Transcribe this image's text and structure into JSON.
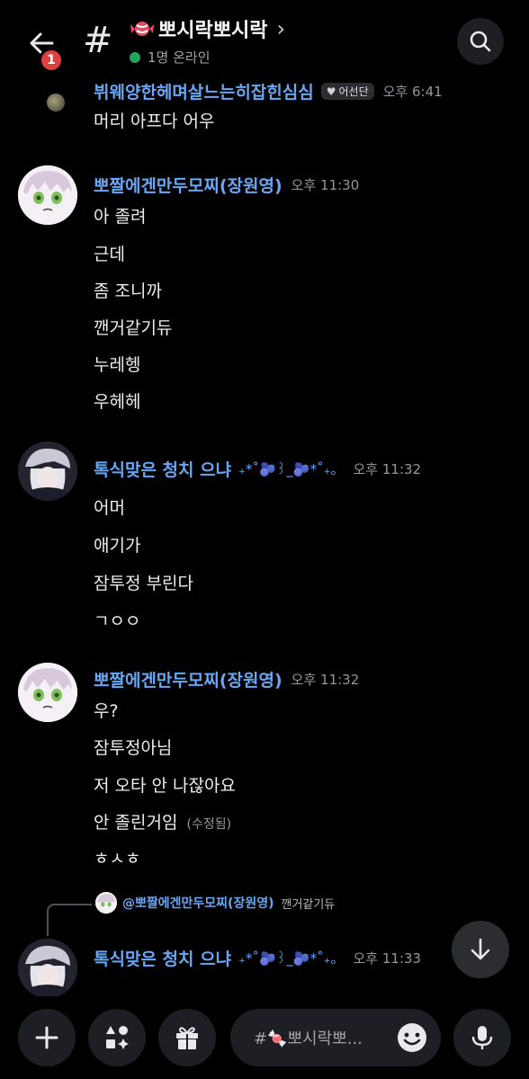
{
  "header": {
    "unread_count": "1",
    "channel_name": "뽀시락뽀시락",
    "online_status": "1명 온라인"
  },
  "messages": [
    {
      "author": "뷔웨양한헤며살느는히잡힌심심",
      "tag": "어선단",
      "time": "오후 6:41",
      "lines": [
        "머리 아프다 어우"
      ]
    },
    {
      "author": "뽀짤에겐만두모찌(장원영)",
      "time": "오후 11:30",
      "lines": [
        "아 졸려",
        "근데",
        "좀 조니까",
        "깬거같기듀",
        "누레헹",
        "우헤헤"
      ]
    },
    {
      "author": "톡식맞은 청치 으냐",
      "decoration": "₊*˚🫐꒱_🫐*˚₊。",
      "time": "오후 11:32",
      "lines": [
        "어머",
        "애기가",
        "잠투정 부린다",
        "ㄱㅇㅇ"
      ]
    },
    {
      "author": "뽀짤에겐만두모찌(장원영)",
      "time": "오후 11:32",
      "lines": [
        "우?",
        "잠투정아님",
        "저 오타 안 나잖아요",
        "안 졸린거임",
        "ㅎㅅㅎ"
      ],
      "edited_label": "(수정됨)"
    },
    {
      "reply_to_author": "@뽀짤에겐만두모찌(장원영)",
      "reply_to_text": "깬거같기듀",
      "author": "톡식맞은 청치 으냐",
      "decoration": "₊*˚🫐꒱_🫐*˚₊。",
      "time": "오후 11:33"
    }
  ],
  "composer": {
    "placeholder": "#🍬뽀시락뽀..."
  },
  "colors": {
    "username": "#68a7f5",
    "online": "#23a55a",
    "badge": "#e0403f",
    "background": "#000000",
    "surface": "#1e1f24"
  }
}
